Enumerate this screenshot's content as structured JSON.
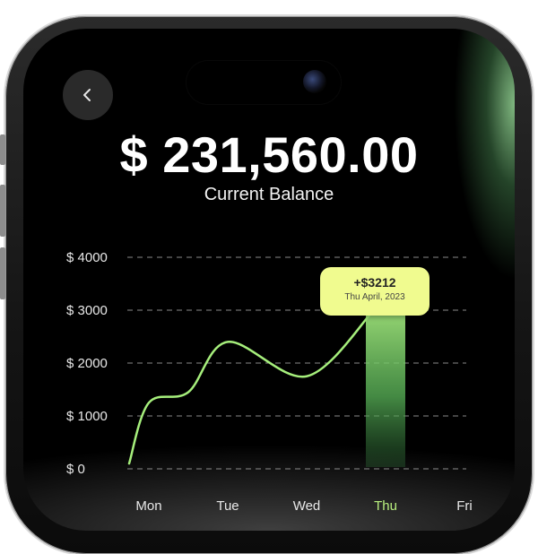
{
  "header": {
    "back_icon": "chevron-left-icon",
    "balance_amount": "$ 231,560.00",
    "balance_label": "Current Balance"
  },
  "colors": {
    "accent": "#b9f07f",
    "line": "#a6ef7c",
    "tooltip_bg": "#f0fb8f",
    "background": "#000000"
  },
  "tooltip": {
    "value": "+$3212",
    "date": "Thu April, 2023"
  },
  "chart_data": {
    "type": "line",
    "categories": [
      "Mon",
      "Tue",
      "Wed",
      "Thu",
      "Fri"
    ],
    "active_category": "Thu",
    "y_ticks": [
      0,
      1000,
      2000,
      3000,
      4000
    ],
    "y_tick_labels": [
      "$ 0",
      "$ 1000",
      "$ 2000",
      "$ 3000",
      "$ 4000"
    ],
    "ylim": [
      0,
      4000
    ],
    "grid": true,
    "grid_style": "dashed",
    "series": [
      {
        "x": [
          -0.25,
          0.0,
          0.5,
          1.0,
          2.0,
          2.85
        ],
        "values": [
          100,
          1250,
          1450,
          2400,
          1750,
          3000
        ]
      }
    ],
    "highlight": {
      "category": "Thu",
      "value": 3000
    }
  }
}
